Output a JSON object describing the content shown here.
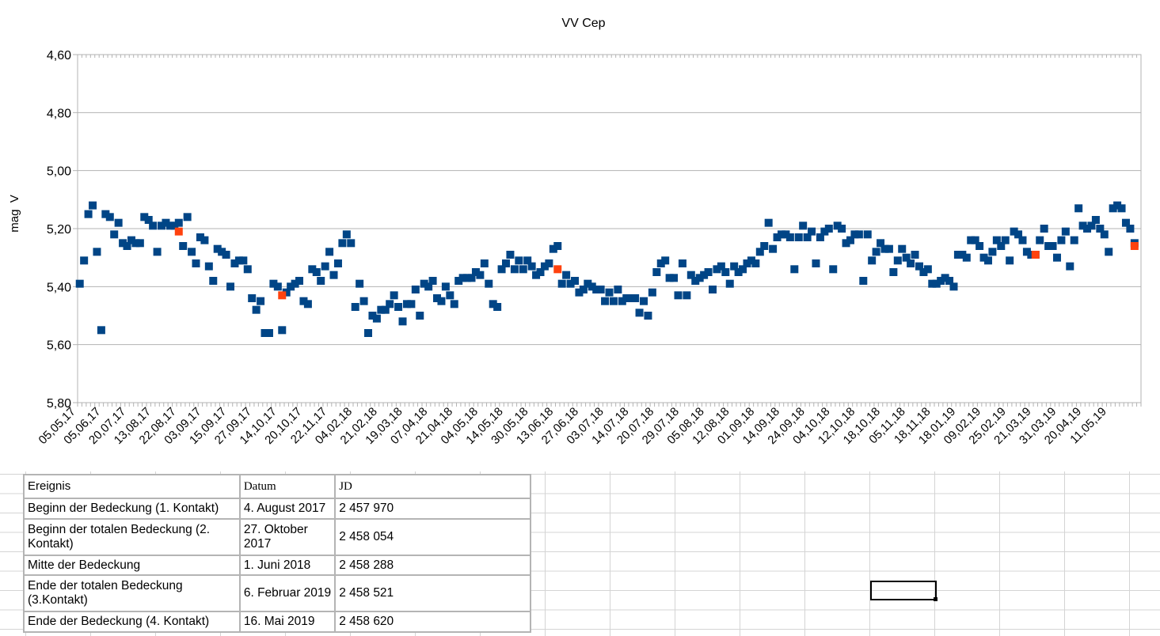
{
  "chart_data": {
    "type": "scatter",
    "title": "VV Cep",
    "ylabel": "mag  V",
    "xlabel": "",
    "ylim": [
      4.6,
      5.8
    ],
    "y_inverted": true,
    "y_ticks": [
      "4,60",
      "4,80",
      "5,00",
      "5,20",
      "5,40",
      "5,60",
      "5,80"
    ],
    "grid": "horizontal",
    "x_ticks": [
      "05,05,17",
      "05,06,17",
      "20,07,17",
      "13,08,17",
      "22,08,17",
      "03,09,17",
      "15,09,17",
      "27,09,17",
      "14,10,17",
      "20,10,17",
      "22,11,17",
      "04,02,18",
      "21,02,18",
      "19,03,18",
      "07,04,18",
      "21,04,18",
      "04,05,18",
      "14,05,18",
      "30,05,18",
      "13,06,18",
      "27,06,18",
      "03,07,18",
      "14,07,18",
      "20,07,18",
      "29,07,18",
      "05,08,18",
      "12,08,18",
      "01,09,18",
      "14,09,18",
      "24,09,18",
      "04,10,18",
      "12,10,18",
      "18,10,18",
      "05,11,18",
      "18,11,18",
      "18,01,19",
      "09,02,19",
      "25,02,19",
      "21,03,19",
      "31,03,19",
      "20,04,19",
      "11,05,19"
    ],
    "series": [
      {
        "color": "#004586",
        "marker": "square",
        "values": [
          5.39,
          5.31,
          5.15,
          5.12,
          5.28,
          5.55,
          5.15,
          5.16,
          5.22,
          5.18,
          5.25,
          5.26,
          5.24,
          5.25,
          5.25,
          5.16,
          5.17,
          5.19,
          5.28,
          5.19,
          5.18,
          5.19,
          5.19,
          5.18,
          5.26,
          5.16,
          5.28,
          5.32,
          5.23,
          5.24,
          5.33,
          5.38,
          5.27,
          5.28,
          5.29,
          5.4,
          5.32,
          5.31,
          5.31,
          5.34,
          5.44,
          5.48,
          5.45,
          5.56,
          5.56,
          5.39,
          5.4,
          5.55,
          5.42,
          5.4,
          5.39,
          5.38,
          5.45,
          5.46,
          5.34,
          5.35,
          5.38,
          5.33,
          5.28,
          5.36,
          5.32,
          5.25,
          5.22,
          5.25,
          5.47,
          5.39,
          5.45,
          5.56,
          5.5,
          5.51,
          5.48,
          5.48,
          5.46,
          5.43,
          5.47,
          5.52,
          5.46,
          5.46,
          5.41,
          5.5,
          5.39,
          5.4,
          5.38,
          5.44,
          5.45,
          5.4,
          5.43,
          5.46,
          5.38,
          5.37,
          5.37,
          5.37,
          5.35,
          5.36,
          5.32,
          5.39,
          5.46,
          5.47,
          5.34,
          5.32,
          5.29,
          5.34,
          5.31,
          5.34,
          5.31,
          5.33,
          5.36,
          5.35,
          5.33,
          5.32,
          5.27,
          5.26,
          5.39,
          5.36,
          5.39,
          5.38,
          5.42,
          5.41,
          5.39,
          5.4,
          5.41,
          5.41,
          5.45,
          5.42,
          5.45,
          5.41,
          5.45,
          5.44,
          5.44,
          5.44,
          5.49,
          5.45,
          5.5,
          5.42,
          5.35,
          5.32,
          5.31,
          5.37,
          5.37,
          5.43,
          5.32,
          5.43,
          5.36,
          5.38,
          5.37,
          5.36,
          5.35,
          5.41,
          5.34,
          5.33,
          5.35,
          5.39,
          5.33,
          5.35,
          5.34,
          5.32,
          5.31,
          5.32,
          5.28,
          5.26,
          5.18,
          5.27,
          5.23,
          5.22,
          5.22,
          5.23,
          5.34,
          5.23,
          5.19,
          5.23,
          5.21,
          5.32,
          5.23,
          5.21,
          5.2,
          5.34,
          5.19,
          5.2,
          5.25,
          5.24,
          5.22,
          5.22,
          5.38,
          5.22,
          5.31,
          5.28,
          5.25,
          5.27,
          5.27,
          5.35,
          5.31,
          5.27,
          5.3,
          5.32,
          5.29,
          5.33,
          5.35,
          5.34,
          5.39,
          5.39,
          5.38,
          5.37,
          5.38,
          5.4,
          5.29,
          5.29,
          5.3,
          5.24,
          5.24,
          5.26,
          5.3,
          5.31,
          5.28,
          5.24,
          5.26,
          5.24,
          5.31,
          5.21,
          5.22,
          5.24,
          5.28,
          5.29,
          5.29,
          5.24,
          5.2,
          5.26,
          5.26,
          5.3,
          5.24,
          5.21,
          5.33,
          5.24,
          5.13,
          5.19,
          5.2,
          5.19,
          5.17,
          5.2,
          5.22,
          5.28,
          5.13,
          5.12,
          5.13,
          5.18,
          5.2,
          5.25
        ]
      },
      {
        "color": "#ff420e",
        "marker": "square",
        "values": [
          5.21,
          5.43,
          5.34,
          5.29,
          5.26
        ]
      }
    ]
  },
  "table": {
    "headers": [
      "Ereignis",
      "Datum",
      "JD"
    ],
    "rows": [
      [
        "Beginn der Bedeckung (1. Kontakt)",
        "4. August 2017",
        "2 457 970"
      ],
      [
        "Beginn der totalen Bedeckung (2. Kontakt)",
        "27. Oktober 2017",
        "2 458 054"
      ],
      [
        "Mitte der Bedeckung",
        "1. Juni 2018",
        "2 458 288"
      ],
      [
        "Ende der totalen Bedeckung (3.Kontakt)",
        "6. Februar 2019",
        "2 458 521"
      ],
      [
        "Ende der Bedeckung (4. Kontakt)",
        "16. Mai 2019",
        "2 458 620"
      ]
    ]
  }
}
